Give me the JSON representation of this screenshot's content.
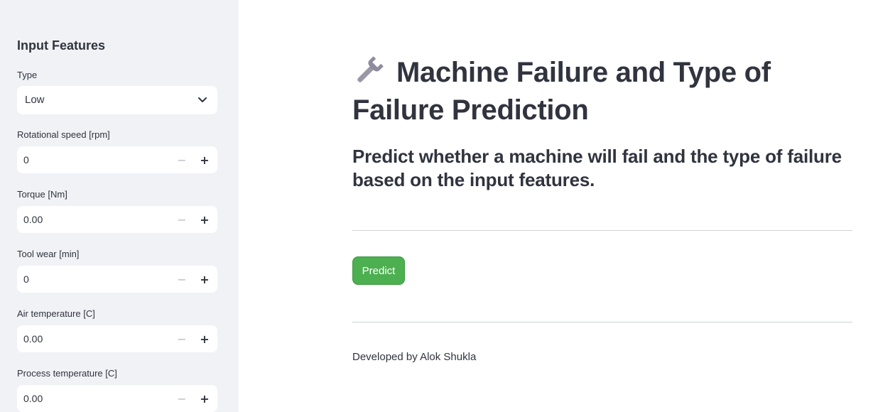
{
  "sidebar": {
    "heading": "Input Features",
    "type_field": {
      "label": "Type",
      "value": "Low"
    },
    "fields": [
      {
        "label": "Rotational speed [rpm]",
        "value": "0"
      },
      {
        "label": "Torque [Nm]",
        "value": "0.00"
      },
      {
        "label": "Tool wear [min]",
        "value": "0"
      },
      {
        "label": "Air temperature [C]",
        "value": "0.00"
      },
      {
        "label": "Process temperature [C]",
        "value": "0.00"
      }
    ],
    "stepper": {
      "minus": "−",
      "plus": "+"
    }
  },
  "main": {
    "title_icon": "wrench-icon",
    "title": "Machine Failure and Type of Failure Prediction",
    "subtitle": "Predict whether a machine will fail and the type of failure based on the input features.",
    "predict_label": "Predict",
    "footer": "Developed by Alok Shukla"
  },
  "colors": {
    "sidebar_bg": "#f0f2f6",
    "primary_button": "#4caf50",
    "text": "#31333f"
  }
}
